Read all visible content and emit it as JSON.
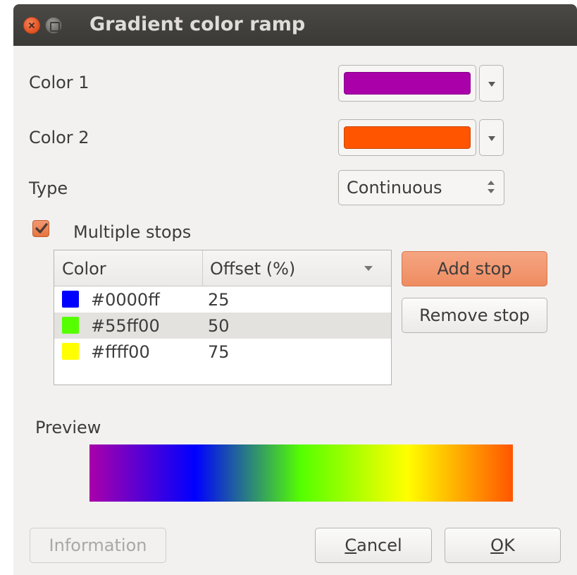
{
  "window": {
    "title": "Gradient color ramp"
  },
  "form": {
    "color1_label": "Color 1",
    "color1_value": "#aa00aa",
    "color2_label": "Color 2",
    "color2_value": "#ff5500",
    "type_label": "Type",
    "type_value": "Continuous",
    "multiple_stops_label": "Multiple stops",
    "multiple_stops_checked": true
  },
  "stops_table": {
    "headers": [
      "Color",
      "Offset (%)"
    ],
    "rows": [
      {
        "color": "#0000ff",
        "hex": "#0000ff",
        "offset": "25"
      },
      {
        "color": "#55ff00",
        "hex": "#55ff00",
        "offset": "50"
      },
      {
        "color": "#ffff00",
        "hex": "#ffff00",
        "offset": "75"
      }
    ]
  },
  "stop_buttons": {
    "add": "Add stop",
    "remove": "Remove stop"
  },
  "preview": {
    "label": "Preview",
    "gradient_stops": [
      {
        "offset": 0,
        "color": "#aa00aa"
      },
      {
        "offset": 25,
        "color": "#0000ff"
      },
      {
        "offset": 50,
        "color": "#55ff00"
      },
      {
        "offset": 75,
        "color": "#ffff00"
      },
      {
        "offset": 100,
        "color": "#ff5500"
      }
    ]
  },
  "footer": {
    "information": "Information",
    "cancel": "Cancel",
    "ok": "OK"
  },
  "colors": {
    "accent": "#ee8c61",
    "titlebar": "#3c3b37",
    "dialog_bg": "#f2f1f0"
  }
}
